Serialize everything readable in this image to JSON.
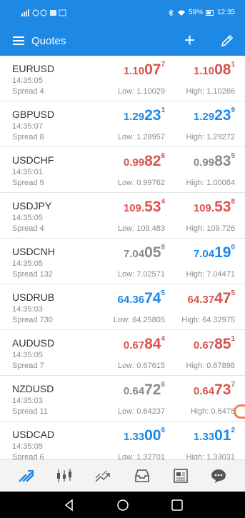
{
  "status": {
    "left_icons": "4G signal wifi",
    "battery": "59%",
    "time": "12:35"
  },
  "header": {
    "title": "Quotes"
  },
  "colors": {
    "accent": "#1e88e5",
    "up": "#1e88e5",
    "down": "#d9534f",
    "neutral": "#8a8a8a"
  },
  "quotes": [
    {
      "symbol": "EURUSD",
      "time": "14:35:05",
      "spread": "Spread 4",
      "bid": {
        "a": "1.10",
        "b": "07",
        "c": "7",
        "color": "red"
      },
      "ask": {
        "a": "1.10",
        "b": "08",
        "c": "1",
        "color": "red"
      },
      "low": "Low: 1.10029",
      "high": "High: 1.10266"
    },
    {
      "symbol": "GBPUSD",
      "time": "14:35:07",
      "spread": "Spread 8",
      "bid": {
        "a": "1.29",
        "b": "23",
        "c": "1",
        "color": "blue"
      },
      "ask": {
        "a": "1.29",
        "b": "23",
        "c": "9",
        "color": "blue"
      },
      "low": "Low: 1.28957",
      "high": "High: 1.29272"
    },
    {
      "symbol": "USDCHF",
      "time": "14:35:01",
      "spread": "Spread 9",
      "bid": {
        "a": "0.99",
        "b": "82",
        "c": "6",
        "color": "red"
      },
      "ask": {
        "a": "0.99",
        "b": "83",
        "c": "5",
        "color": "gray"
      },
      "low": "Low: 0.99762",
      "high": "High: 1.00084"
    },
    {
      "symbol": "USDJPY",
      "time": "14:35:05",
      "spread": "Spread 4",
      "bid": {
        "a": "109.",
        "b": "53",
        "c": "4",
        "color": "red"
      },
      "ask": {
        "a": "109.",
        "b": "53",
        "c": "8",
        "color": "red"
      },
      "low": "Low: 109.483",
      "high": "High: 109.726"
    },
    {
      "symbol": "USDCNH",
      "time": "14:35:05",
      "spread": "Spread 132",
      "bid": {
        "a": "7.04",
        "b": "05",
        "c": "8",
        "color": "gray"
      },
      "ask": {
        "a": "7.04",
        "b": "19",
        "c": "0",
        "color": "blue"
      },
      "low": "Low: 7.02571",
      "high": "High: 7.04471"
    },
    {
      "symbol": "USDRUB",
      "time": "14:35:03",
      "spread": "Spread 730",
      "bid": {
        "a": "64.36",
        "b": "74",
        "c": "5",
        "color": "blue"
      },
      "ask": {
        "a": "64.37",
        "b": "47",
        "c": "5",
        "color": "red"
      },
      "low": "Low: 64.25805",
      "high": "High: 64.32975"
    },
    {
      "symbol": "AUDUSD",
      "time": "14:35:05",
      "spread": "Spread 7",
      "bid": {
        "a": "0.67",
        "b": "84",
        "c": "4",
        "color": "red"
      },
      "ask": {
        "a": "0.67",
        "b": "85",
        "c": "1",
        "color": "red"
      },
      "low": "Low: 0.67615",
      "high": "High: 0.67898"
    },
    {
      "symbol": "NZDUSD",
      "time": "14:35:03",
      "spread": "Spread 11",
      "bid": {
        "a": "0.64",
        "b": "72",
        "c": "6",
        "color": "gray"
      },
      "ask": {
        "a": "0.64",
        "b": "73",
        "c": "7",
        "color": "red"
      },
      "low": "Low: 0.64237",
      "high": "High: 0.6475"
    },
    {
      "symbol": "USDCAD",
      "time": "14:35:05",
      "spread": "Spread 6",
      "bid": {
        "a": "1.33",
        "b": "00",
        "c": "6",
        "color": "blue"
      },
      "ask": {
        "a": "1.33",
        "b": "01",
        "c": "2",
        "color": "blue"
      },
      "low": "Low: 1.32701",
      "high": "High: 1.33031"
    }
  ],
  "tabs": [
    "quotes-icon",
    "chart-icon",
    "trade-icon",
    "history-icon",
    "news-icon",
    "chat-icon"
  ],
  "nav": [
    "back-icon",
    "home-icon",
    "recents-icon"
  ]
}
